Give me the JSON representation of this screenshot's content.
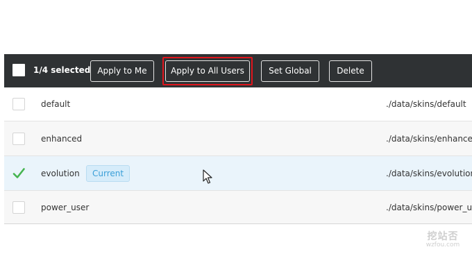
{
  "toolbar": {
    "selected_count": "1/4 selected",
    "buttons": {
      "apply_me": "Apply to Me",
      "apply_all": "Apply to All Users",
      "set_global": "Set Global",
      "delete": "Delete"
    }
  },
  "skins": [
    {
      "name": "default",
      "path": "./data/skins/default",
      "checked": false
    },
    {
      "name": "enhanced",
      "path": "./data/skins/enhanced",
      "checked": false
    },
    {
      "name": "evolution",
      "path": "./data/skins/evolution",
      "checked": true,
      "badge": "Current"
    },
    {
      "name": "power_user",
      "path": "./data/skins/power_user",
      "checked": false
    }
  ],
  "watermark": {
    "text": "挖站否",
    "domain": "wzfou.com"
  },
  "colors": {
    "toolbar_bg": "#2f3234",
    "highlight_border": "#e0141c",
    "badge_text": "#3a9fd8",
    "check_green": "#46b450",
    "selected_row_bg": "#eaf4fb"
  }
}
